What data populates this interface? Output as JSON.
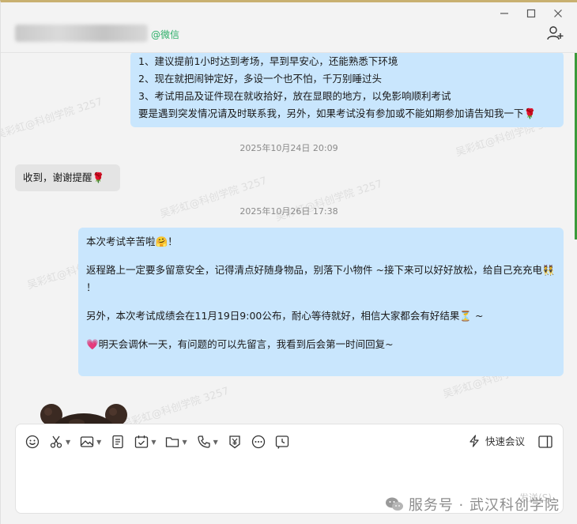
{
  "titlebar": {
    "contact_name": "██████████",
    "contact_source": "@微信",
    "minimize_icon": "minimize-icon",
    "maximize_icon": "maximize-icon",
    "close_icon": "close-icon",
    "add_member_icon": "add-member-icon"
  },
  "messages": {
    "msg1_lines": [
      "1、建议提前1小时达到考场，早到早安心，还能熟悉下环境",
      "2、现在就把闹钟定好，多设一个也不怕，千万别睡过头",
      "3、考试用品及证件现在就收拾好，放在显眼的地方，以免影响顺利考试",
      "要是遇到突发情况请及时联系我，另外，如果考试没有参加或不能如期参加请告知我一下"
    ],
    "msg1_emoji": "🌹",
    "time1": "2025年10月24日 20:09",
    "reply_text": "收到，谢谢提醒",
    "reply_emoji": "🌹",
    "time2": "2025年10月26日 17:38",
    "msg2_l1": "本次考试辛苦啦",
    "msg2_l1_emoji": "🤗",
    "msg2_l1_end": "！",
    "msg2_l2": "返程路上一定要多留意安全，记得清点好随身物品，别落下小物件 ~接下来可以好好放松，给自己充充电",
    "msg2_l2_emoji": "👯",
    "msg2_l2_end": "！",
    "msg2_l3": "另外，本次考试成绩会在11月19日9:00公布，耐心等待就好，相信大家都会有好结果",
    "msg2_l3_emoji": "⏳",
    "msg2_l3_end": " ~",
    "msg2_l4_emoji": "💗",
    "msg2_l4": "明天会调休一天，有问题的可以先留言，我看到后会第一时间回复~"
  },
  "watermark_text": "吴彩虹@科创学院 3257",
  "composer": {
    "tools": [
      "emoji-icon",
      "scissors-icon",
      "image-icon",
      "document-icon",
      "check-calendar-icon",
      "folder-icon",
      "phone-icon",
      "yen-icon",
      "more-icon",
      "clock-icon"
    ],
    "quick_meeting_label": "快速会议",
    "input_value": "",
    "send_label": "发送(S)"
  },
  "service_mark": "服务号 · 武汉科创学院",
  "colors": {
    "my_bubble": "#c9e6fd",
    "other_bubble": "#e4e4e4",
    "wechat_green": "#2aae67",
    "background": "#f3f3f3"
  }
}
